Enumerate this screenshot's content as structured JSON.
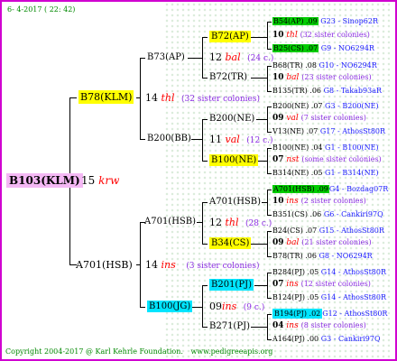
{
  "header": {
    "date": "6- 4-2017 ( 22: 42)"
  },
  "footer": {
    "copyright": "Copyright 2004-2017 @ Karl Kehrle Foundation.",
    "website": "www.pedigreeapis.org"
  },
  "root": {
    "label": "B103(KLM)",
    "gen_num": "15",
    "gen_word": "krw"
  },
  "g1": [
    {
      "id": "B78(KLM)",
      "gen_num": "14",
      "gen_word": "thl",
      "sisters": "(32 sister colonies)"
    },
    {
      "id": "A701(HSB)",
      "gen_num": "14",
      "gen_word": "ins",
      "sisters": "(3 sister colonies)"
    }
  ],
  "g2": [
    {
      "id": "B73(AP)"
    },
    {
      "id": "B200(BB)",
      "gen_num": "11",
      "gen_word": "val",
      "sisters": "(12 c.)"
    },
    {
      "id": "A701(HSB)",
      "gen_num": "12",
      "gen_word": "thl",
      "sisters": "(28 c.)"
    },
    {
      "id": "B100(JG)",
      "gen_num": "09",
      "gen_word": "ins",
      "sisters": "(9 c.)"
    }
  ],
  "g3": [
    {
      "id": "B72(AP)",
      "gen_num": "12",
      "gen_word": "bal",
      "sisters": "(24 c.)"
    },
    {
      "id": "B72(TR)"
    },
    {
      "id": "B200(NE)"
    },
    {
      "id": "B100(NE)"
    },
    {
      "id": "A701(HSB)"
    },
    {
      "id": "B34(CS)"
    },
    {
      "id": "B201(PJ)"
    },
    {
      "id": "B271(PJ)"
    }
  ],
  "g4": [
    {
      "id": "B54(AP) .09",
      "ref": "G23 - Sinop62R"
    },
    {
      "num": "10",
      "word": "thl",
      "sisters": "(32 sister colonies)"
    },
    {
      "id": "B25(CS) .07",
      "ref": "G9 - NO6294R"
    },
    {
      "id": "B68(TR) .08",
      "ref": "G10 - NO6294R"
    },
    {
      "num": "10",
      "word": "bal",
      "sisters": "(23 sister colonies)"
    },
    {
      "id": "B135(TR) .06",
      "ref": "G8 - Takab93aR"
    },
    {
      "id": "B200(NE) .07",
      "ref": "G3 - B200(NE)"
    },
    {
      "num": "09",
      "word": "val",
      "sisters": "(7 sister colonies)"
    },
    {
      "id": "V13(NE) .07",
      "ref": "G17 - AthosSt80R"
    },
    {
      "id": "B100(NE) .04",
      "ref": "G1 - B100(NE)"
    },
    {
      "num": "07",
      "word": "nst",
      "sisters": "(some sister colonies)"
    },
    {
      "id": "B314(NE) .05",
      "ref": "G1 - B314(NE)"
    },
    {
      "id": "A701(HSB) .09",
      "ref": "G4 - Bozdag07R"
    },
    {
      "num": "10",
      "word": "ins",
      "sisters": "(2 sister colonies)"
    },
    {
      "id": "B351(CS) .06",
      "ref": "G6 - Cankiri97Q"
    },
    {
      "id": "B24(CS) .07",
      "ref": "G15 - AthosSt80R"
    },
    {
      "num": "09",
      "word": "bal",
      "sisters": "(21 sister colonies)"
    },
    {
      "id": "B78(TR) .06",
      "ref": "G8 - NO6294R"
    },
    {
      "id": "B284(PJ) .05",
      "ref": "G14 - AthosSt80R"
    },
    {
      "num": "07",
      "word": "ins",
      "sisters": "(12 sister colonies)"
    },
    {
      "id": "B124(PJ) .05",
      "ref": "G14 - AthosSt80R"
    },
    {
      "id": "B194(PJ) .02",
      "ref": "G12 - AthosSt80R"
    },
    {
      "num": "04",
      "word": "ins",
      "sisters": "(8 sister colonies)"
    },
    {
      "id": "A164(PJ) .00",
      "ref": "G3 - Cankiri97Q"
    }
  ]
}
